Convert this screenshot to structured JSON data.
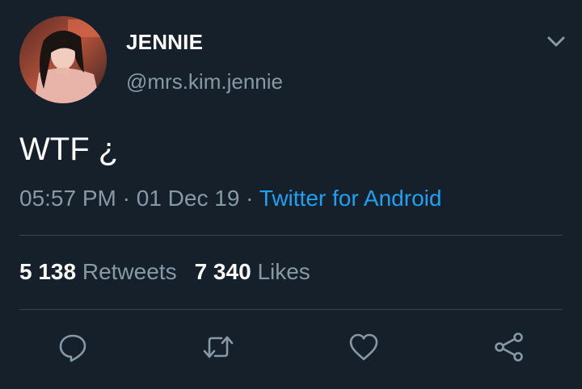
{
  "user": {
    "name": "JENNIE",
    "handle": "@mrs.kim.jennie"
  },
  "tweet": {
    "text": "WTF ¿",
    "time": "05:57 PM",
    "sep1": " · ",
    "date": "01 Dec 19",
    "sep2": " · ",
    "source": "Twitter for Android"
  },
  "stats": {
    "retweets_count": "5 138",
    "retweets_label": "Retweets",
    "likes_count": "7 340",
    "likes_label": "Likes"
  },
  "actions": [
    "reply-icon",
    "retweet-icon",
    "like-icon",
    "share-icon"
  ],
  "colors": {
    "background": "#15202b",
    "secondary_text": "#8899a6",
    "link": "#1da1f2",
    "divider": "#38444d"
  }
}
